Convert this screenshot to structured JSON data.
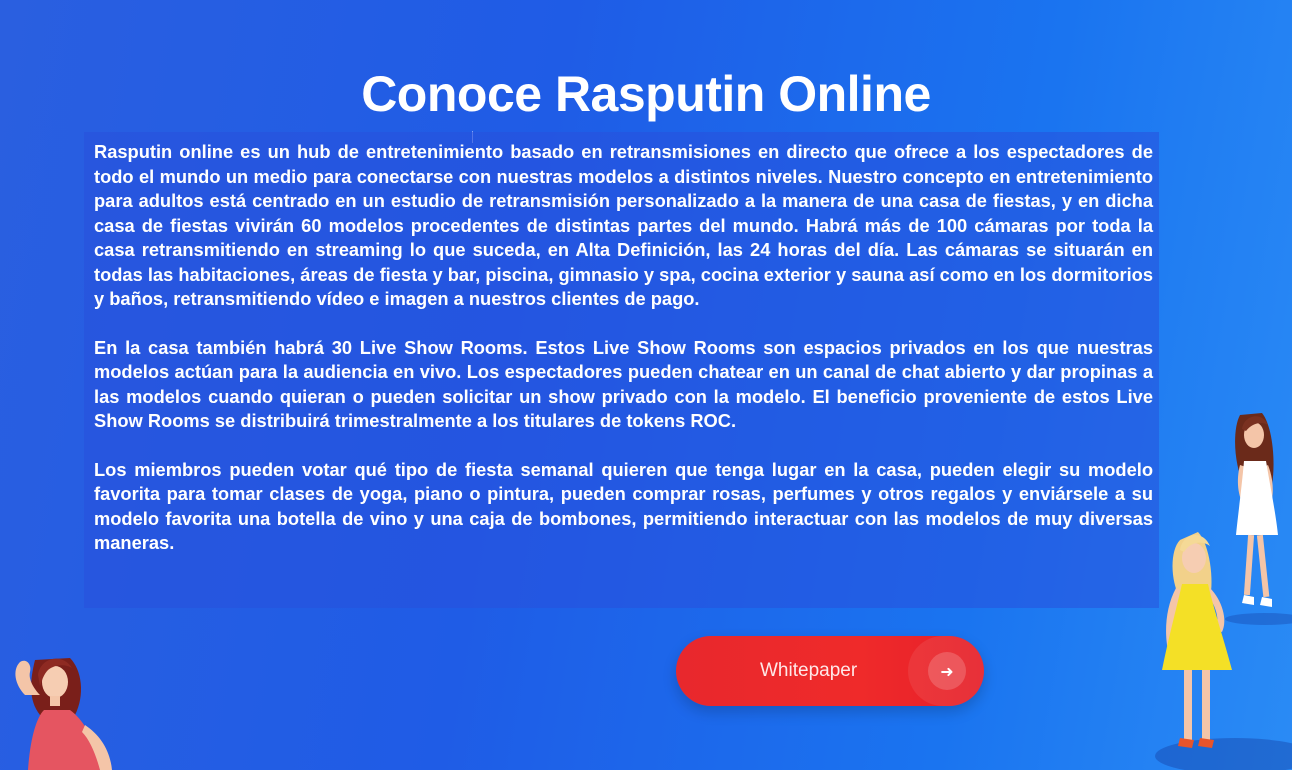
{
  "section": {
    "title": "Conoce Rasputin Online",
    "paragraphs": [
      "Rasputin online es un hub de entretenimiento basado en retransmisiones en directo que ofrece a los espectadores de todo el mundo un medio para conectarse con nuestras modelos a distintos niveles. Nuestro concepto en entretenimiento para adultos está centrado en un estudio de retransmisión personalizado a la manera de una casa de fiestas, y en dicha casa de fiestas vivirán 60 modelos procedentes de distintas partes del mundo. Habrá más de 100 cámaras por toda la casa retransmitiendo en streaming lo que suceda, en Alta Definición, las 24 horas del día. Las cámaras se situarán en todas las habitaciones,  áreas de fiesta y bar, piscina, gimnasio y spa, cocina exterior y sauna así como en los dormitorios y baños, retransmitiendo vídeo e imagen a nuestros clientes de pago.",
      "En la casa también habrá 30 Live Show Rooms. Estos Live Show Rooms son espacios privados en los que nuestras modelos actúan para la audiencia en vivo. Los espectadores pueden chatear en un canal de chat abierto y dar propinas a las modelos cuando quieran o pueden solicitar un show privado con la modelo. El beneficio proveniente de estos Live Show Rooms se distribuirá trimestralmente a los titulares de tokens ROC.",
      "Los miembros pueden votar qué tipo de fiesta semanal quieren que tenga lugar en la casa, pueden elegir su modelo favorita para tomar clases de yoga, piano o pintura, pueden comprar rosas, perfumes y otros regalos y enviársele a su modelo favorita una botella de vino y una caja de bombones, permitiendo interactuar con las modelos de muy diversas maneras."
    ]
  },
  "cta": {
    "label": "Whitepaper",
    "icon": "arrow-right-icon",
    "color": "#e8282d"
  },
  "illustrations": {
    "left": "woman-red-dress-illustration",
    "right_top": "woman-white-dress-illustration",
    "right_bottom": "woman-yellow-dress-illustration"
  },
  "colors": {
    "background_start": "#2a5fe0",
    "background_end": "#2a8bf5",
    "text": "#ffffff"
  }
}
